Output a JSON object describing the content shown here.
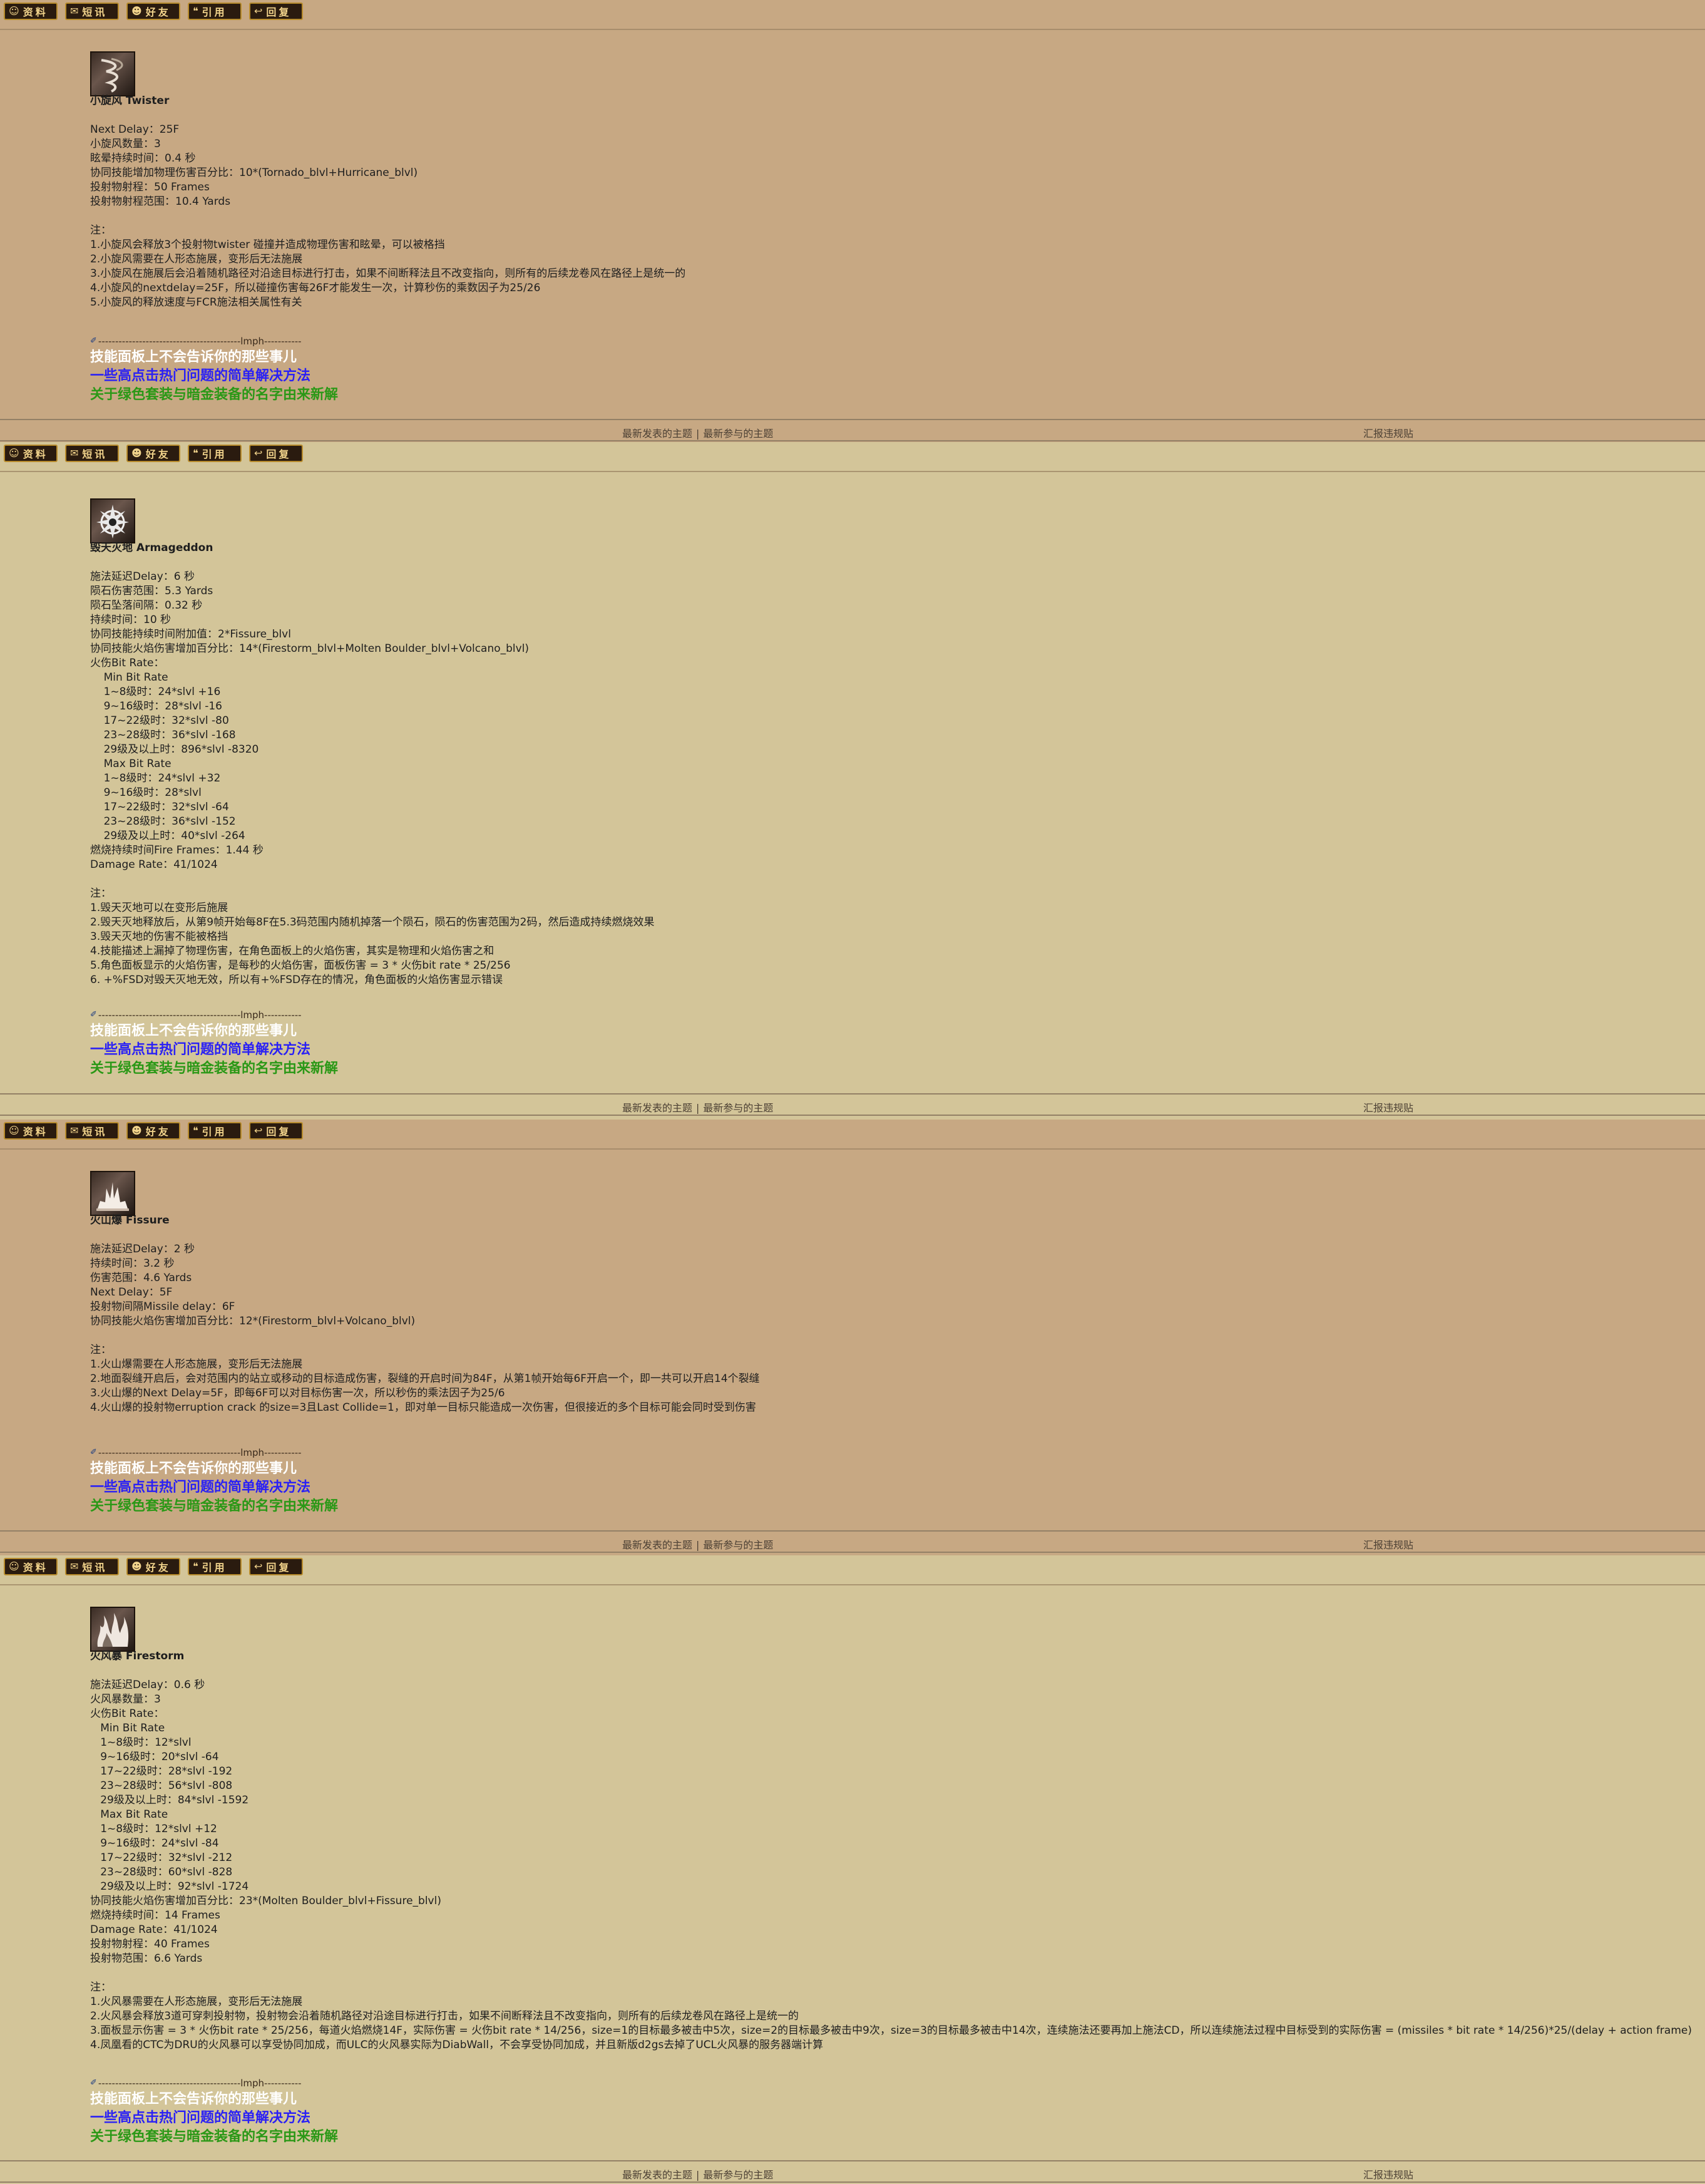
{
  "toolbar_buttons": [
    {
      "name": "profile",
      "icon": "profile-icon",
      "label": "资料"
    },
    {
      "name": "message",
      "icon": "message-icon",
      "label": "短讯"
    },
    {
      "name": "friend",
      "icon": "friend-icon",
      "label": "好友"
    },
    {
      "name": "quote",
      "icon": "quote-icon",
      "label": "引用"
    },
    {
      "name": "reply",
      "icon": "reply-icon",
      "label": "回复"
    }
  ],
  "signature": {
    "divider": "------------------------------------------lmph-----------",
    "links": [
      {
        "text": "技能面板上不会告诉你的那些事儿",
        "color": "#ffffff"
      },
      {
        "text": "一些高点击热门问题的简单解决方法",
        "color": "#2a20f5"
      },
      {
        "text": "关于绿色套装与暗金装备的名字由来新解",
        "color": "#2a9816"
      }
    ]
  },
  "footer": {
    "latest_posts": "最新发表的主题",
    "separator": "|",
    "latest_replies": "最新参与的主题",
    "report": "汇报违规贴"
  },
  "posts": [
    {
      "skill_icon": "twister-skill-icon",
      "title": "小旋风 Twister",
      "lines": [
        "",
        "Next Delay：25F",
        "小旋风数量：3",
        "眩晕持续时间：0.4 秒",
        "协同技能增加物理伤害百分比：10*(Tornado_blvl+Hurricane_blvl)",
        "投射物射程：50 Frames",
        "投射物射程范围：10.4 Yards",
        "",
        "注：",
        "1.小旋风会释放3个投射物twister 碰撞并造成物理伤害和眩晕，可以被格挡",
        "2.小旋风需要在人形态施展，变形后无法施展",
        "3.小旋风在施展后会沿着随机路径对沿途目标进行打击，如果不间断释法且不改变指向，则所有的后续龙卷风在路径上是统一的",
        "4.小旋风的nextdelay=25F，所以碰撞伤害每26F才能发生一次，计算秒伤的乘数因子为25/26",
        "5.小旋风的释放速度与FCR施法相关属性有关"
      ]
    },
    {
      "skill_icon": "armageddon-skill-icon",
      "title": "毁天灭地 Armageddon",
      "lines": [
        "",
        "施法延迟Delay：6 秒",
        "陨石伤害范围：5.3 Yards",
        "陨石坠落间隔：0.32 秒",
        "持续时间：10 秒",
        "协同技能持续时间附加值：2*Fissure_blvl",
        "协同技能火焰伤害增加百分比：14*(Firestorm_blvl+Molten Boulder_blvl+Volcano_blvl)",
        "火伤Bit Rate：",
        "    Min Bit Rate",
        "    1~8级时：24*slvl +16",
        "    9~16级时：28*slvl -16",
        "    17~22级时：32*slvl -80",
        "    23~28级时：36*slvl -168",
        "    29级及以上时：896*slvl -8320",
        "    Max Bit Rate",
        "    1~8级时：24*slvl +32",
        "    9~16级时：28*slvl",
        "    17~22级时：32*slvl -64",
        "    23~28级时：36*slvl -152",
        "    29级及以上时：40*slvl -264",
        "燃烧持续时间Fire Frames：1.44 秒",
        "Damage Rate：41/1024",
        "",
        "注：",
        "1.毁天灭地可以在变形后施展",
        "2.毁天灭地释放后，从第9帧开始每8F在5.3码范围内随机掉落一个陨石，陨石的伤害范围为2码，然后造成持续燃烧效果",
        "3.毁天灭地的伤害不能被格挡",
        "4.技能描述上漏掉了物理伤害，在角色面板上的火焰伤害，其实是物理和火焰伤害之和",
        "5.角色面板显示的火焰伤害，是每秒的火焰伤害，面板伤害 = 3 * 火伤bit rate * 25/256",
        "6. +%FSD对毁天灭地无效，所以有+%FSD存在的情况，角色面板的火焰伤害显示错误"
      ]
    },
    {
      "skill_icon": "fissure-skill-icon",
      "title": "火山爆 Fissure",
      "lines": [
        "",
        "施法延迟Delay：2 秒",
        "持续时间：3.2 秒",
        "伤害范围：4.6 Yards",
        "Next Delay：5F",
        "投射物间隔Missile delay：6F",
        "协同技能火焰伤害增加百分比：12*(Firestorm_blvl+Volcano_blvl)",
        "",
        "注：",
        "1.火山爆需要在人形态施展，变形后无法施展",
        "2.地面裂缝开启后，会对范围内的站立或移动的目标造成伤害，裂缝的开启时间为84F，从第1帧开始每6F开启一个，即一共可以开启14个裂缝",
        "3.火山爆的Next Delay=5F，即每6F可以对目标伤害一次，所以秒伤的乘法因子为25/6",
        "4.火山爆的投射物erruption crack 的size=3且Last Collide=1，即对单一目标只能造成一次伤害，但很接近的多个目标可能会同时受到伤害"
      ]
    },
    {
      "skill_icon": "firestorm-skill-icon",
      "title": "火风暴 Firestorm",
      "lines": [
        "",
        "施法延迟Delay：0.6 秒",
        "火风暴数量：3",
        "火伤Bit Rate：",
        "   Min Bit Rate",
        "   1~8级时：12*slvl",
        "   9~16级时：20*slvl -64",
        "   17~22级时：28*slvl -192",
        "   23~28级时：56*slvl -808",
        "   29级及以上时：84*slvl -1592",
        "   Max Bit Rate",
        "   1~8级时：12*slvl +12",
        "   9~16级时：24*slvl -84",
        "   17~22级时：32*slvl -212",
        "   23~28级时：60*slvl -828",
        "   29级及以上时：92*slvl -1724",
        "协同技能火焰伤害增加百分比：23*(Molten Boulder_blvl+Fissure_blvl)",
        "燃烧持续时间：14 Frames",
        "Damage Rate：41/1024",
        "投射物射程：40 Frames",
        "投射物范围：6.6 Yards",
        "",
        "注：",
        "1.火风暴需要在人形态施展，变形后无法施展",
        "2.火风暴会释放3道可穿刺投射物，投射物会沿着随机路径对沿途目标进行打击，如果不间断释法且不改变指向，则所有的后续龙卷风在路径上是统一的",
        "3.面板显示伤害 = 3 * 火伤bit rate * 25/256，每道火焰燃烧14F，实际伤害 = 火伤bit rate * 14/256，size=1的目标最多被击中5次，size=2的目标最多被击中9次，size=3的目标最多被击中14次，连续施法还要再加上施法CD，所以连续施法过程中目标受到的实际伤害 = (missiles * bit rate * 14/256)*25/(delay + action frame)",
        "4.凤凰看的CTC为DRU的火风暴可以享受协同加成，而ULC的火风暴实际为DiabWall，不会享受协同加成，并且新版d2gs去掉了UCL火风暴的服务器端计算"
      ]
    }
  ]
}
